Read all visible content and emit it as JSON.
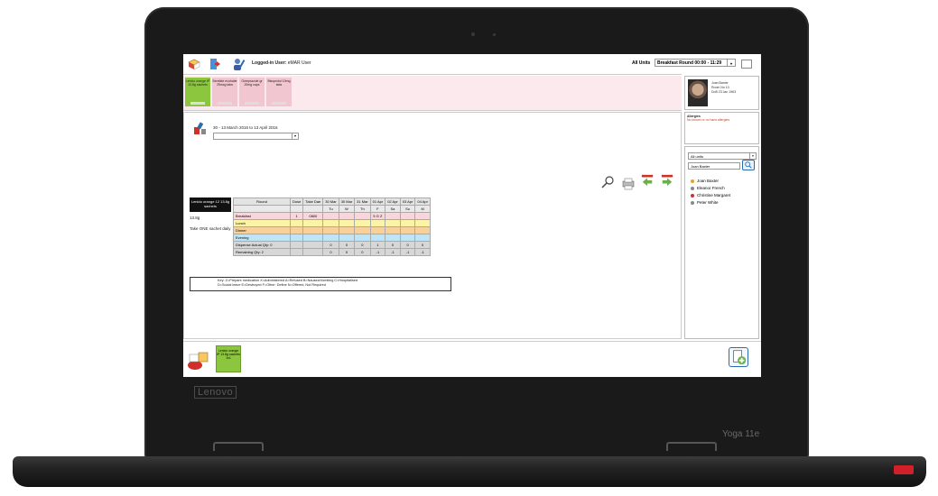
{
  "device": {
    "bezel_logo": "Lenovo",
    "model": "Yoga 11e"
  },
  "toolbar": {
    "logged_in_label": "Logged-in User:",
    "logged_in_user": "eMAR User",
    "units_label": "All Units",
    "round_selected": "Breakfast Round 00:00 - 11:29"
  },
  "meds_strip": [
    {
      "label": "Lenido orange IP 13.8g sachets",
      "color": "#8cc63f"
    },
    {
      "label": "Seretide evohaler 25mcg tabs",
      "color": "#f2c6d0"
    },
    {
      "label": "Omeprazole gr 20mg caps",
      "color": "#f2c6d0"
    },
    {
      "label": "Bisoprolol 10mg tabs",
      "color": "#f2c6d0"
    }
  ],
  "patient": {
    "name": "Joan Baxter",
    "room": "Room No 10",
    "dob": "DoB 23 Jan 1963",
    "allergies_label": "Allergies",
    "allergies_value": "No known or no hans allergies"
  },
  "main": {
    "date_range": "30 - 13 March 2016 to 13 April 2016",
    "med_name": "Lenido orange 12 13.8g sachets",
    "dose_note": "13.8g\n\nTake ONE sachet daily",
    "headers": [
      "Round",
      "Dose",
      "Take Dae",
      "30 Mar",
      "30 Mar",
      "31 Mar",
      "01 Apr",
      "02 Apr",
      "03 Apr",
      "04 Apr"
    ],
    "subheaders": [
      "",
      "",
      "",
      "Tu",
      "W",
      "Th",
      "F",
      "Sa",
      "Su",
      "M"
    ],
    "rows": [
      {
        "label": "Breakfast",
        "cls": "bf",
        "cells": [
          "1",
          "0800",
          "",
          "",
          "",
          "5 G Z",
          "",
          "",
          ""
        ]
      },
      {
        "label": "Lunch",
        "cls": "ln",
        "cells": [
          "",
          "",
          "",
          "",
          "",
          "",
          "",
          "",
          ""
        ]
      },
      {
        "label": "Dinner",
        "cls": "dn",
        "cells": [
          "",
          "",
          "",
          "",
          "",
          "",
          "",
          "",
          ""
        ]
      },
      {
        "label": "Evening",
        "cls": "ev",
        "cells": [
          "",
          "",
          "",
          "",
          "",
          "",
          "",
          "",
          ""
        ]
      },
      {
        "label": "Dispense Actual Qty: 0",
        "cls": "gr",
        "cells": [
          "",
          "",
          "0",
          "0",
          "0",
          "1",
          "0",
          "0",
          "0"
        ]
      },
      {
        "label": "Remaining Qty: 2",
        "cls": "gr",
        "cells": [
          "",
          "",
          "0",
          "0",
          "0",
          "-1",
          "-1",
          "-1",
          "-1"
        ]
      }
    ],
    "key_line1": "Key: Z=Prepare medication X=Administered A=Refused B=Nausea/Vomiting C=Hospitalised",
    "key_line2": "D=Social leave E=Destroyed F=Other: Define N=Offered, Not Required"
  },
  "patients_panel": {
    "units_select": "All units",
    "search_value": "Joan Baxter",
    "patients": [
      {
        "name": "Joan Baxter",
        "color": "#f0a020"
      },
      {
        "name": "Eleanor French",
        "color": "#888888"
      },
      {
        "name": "Christine Margaret",
        "color": "#d0302a"
      },
      {
        "name": "Peter White",
        "color": "#888888"
      }
    ]
  },
  "bottom": {
    "tile_label": "Lenido orange IP 13.8g sachets 1x1"
  }
}
